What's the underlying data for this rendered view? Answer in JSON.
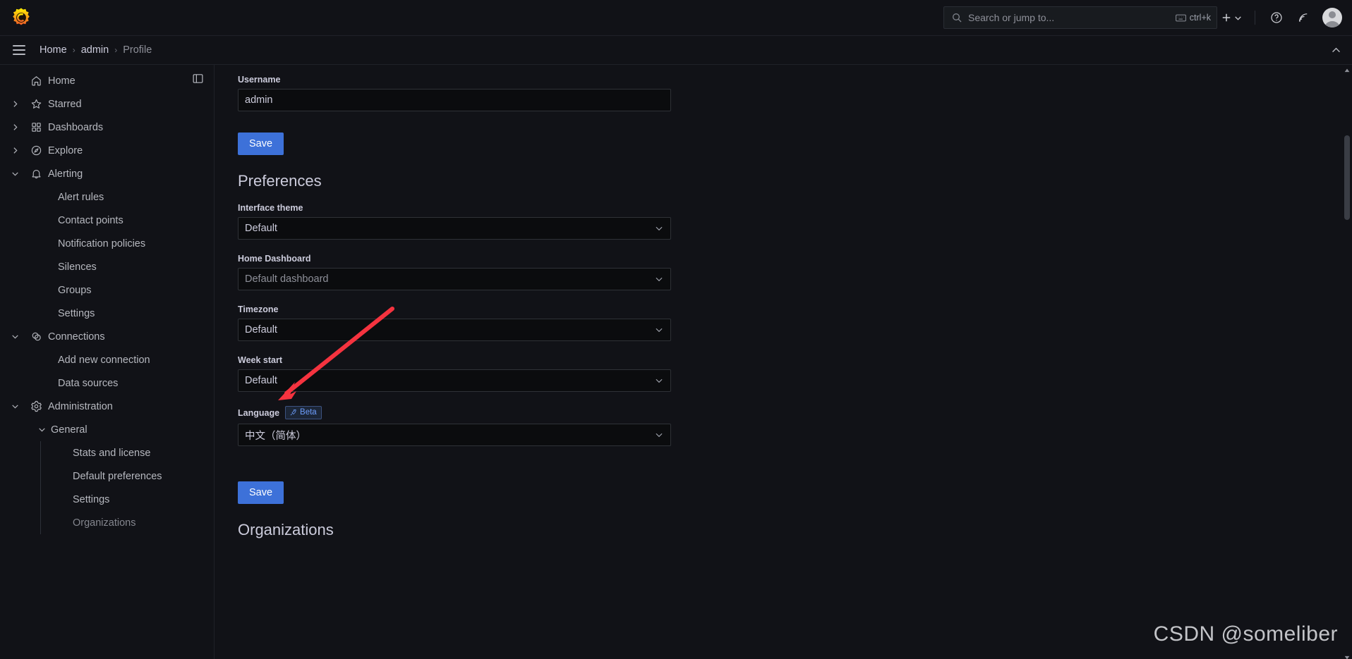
{
  "topbar": {
    "logo_name": "grafana-logo",
    "search": {
      "placeholder": "Search or jump to...",
      "shortcut": "ctrl+k"
    },
    "new_label": "+",
    "help_label": "?",
    "icons": [
      "plus-icon",
      "chevron-down-icon",
      "help-circle-icon",
      "news-rss-icon",
      "avatar"
    ]
  },
  "breadcrumb": {
    "items": [
      {
        "label": "Home"
      },
      {
        "label": "admin"
      },
      {
        "label": "Profile"
      }
    ],
    "separator": "›"
  },
  "sidebar": {
    "items": [
      {
        "label": "Home",
        "icon": "home-icon",
        "level": 1,
        "expandable": false,
        "expanded": false
      },
      {
        "label": "Starred",
        "icon": "star-icon",
        "level": 1,
        "expandable": true,
        "expanded": false
      },
      {
        "label": "Dashboards",
        "icon": "dashboards-grid-icon",
        "level": 1,
        "expandable": true,
        "expanded": false
      },
      {
        "label": "Explore",
        "icon": "compass-icon",
        "level": 1,
        "expandable": true,
        "expanded": false
      },
      {
        "label": "Alerting",
        "icon": "bell-icon",
        "level": 1,
        "expandable": true,
        "expanded": true
      },
      {
        "label": "Alert rules",
        "level": 2
      },
      {
        "label": "Contact points",
        "level": 2
      },
      {
        "label": "Notification policies",
        "level": 2
      },
      {
        "label": "Silences",
        "level": 2
      },
      {
        "label": "Groups",
        "level": 2
      },
      {
        "label": "Settings",
        "level": 2
      },
      {
        "label": "Connections",
        "icon": "connections-icon",
        "level": 1,
        "expandable": true,
        "expanded": true
      },
      {
        "label": "Add new connection",
        "level": 2
      },
      {
        "label": "Data sources",
        "level": 2
      },
      {
        "label": "Administration",
        "icon": "gear-icon",
        "level": 1,
        "expandable": true,
        "expanded": true
      },
      {
        "label": "General",
        "level": 3,
        "expandable": true,
        "expanded": true
      },
      {
        "label": "Stats and license",
        "level": 4
      },
      {
        "label": "Default preferences",
        "level": 4
      },
      {
        "label": "Settings",
        "level": 4
      },
      {
        "label": "Organizations",
        "level": 4,
        "dim": true
      }
    ],
    "dock_icon": "dock-panel-icon"
  },
  "main": {
    "username_field": {
      "label": "Username",
      "value": "admin"
    },
    "save_profile_label": "Save",
    "preferences_heading": "Preferences",
    "fields": [
      {
        "label": "Interface theme",
        "value": "Default",
        "placeholder": false
      },
      {
        "label": "Home Dashboard",
        "value": "Default dashboard",
        "placeholder": true
      },
      {
        "label": "Timezone",
        "value": "Default",
        "placeholder": false
      },
      {
        "label": "Week start",
        "value": "Default",
        "placeholder": false
      }
    ],
    "language_field": {
      "label": "Language",
      "badge": "Beta",
      "badge_icon": "rocket-icon",
      "value": "中文（简体）"
    },
    "save_preferences_label": "Save",
    "organizations_heading": "Organizations"
  },
  "watermark": "CSDN @someliber",
  "colors": {
    "accent_blue": "#3d71d9",
    "badge_blue": "#6e9fff",
    "background": "#111217",
    "panel": "#0b0c0e",
    "text": "#ccccdc",
    "text_dim": "#8e9099",
    "annotation_red": "#f5333f"
  }
}
